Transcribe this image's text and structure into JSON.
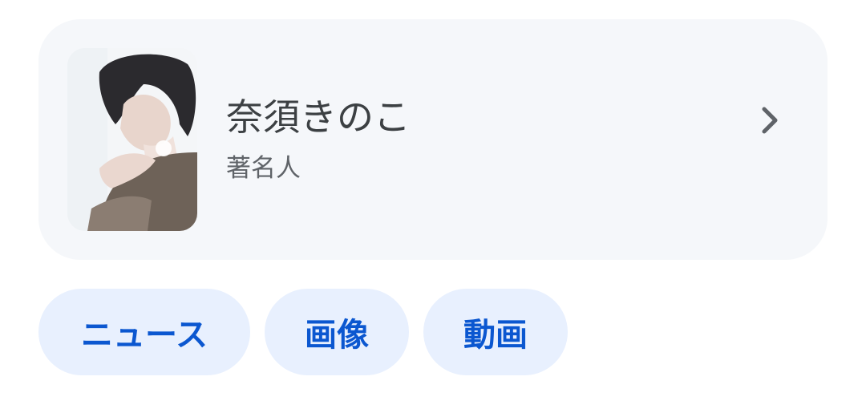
{
  "entity": {
    "name": "奈須きのこ",
    "category": "著名人",
    "thumbnail_icon": "person-photo",
    "chevron_icon": "chevron-right-icon"
  },
  "chips": [
    {
      "label": "ニュース"
    },
    {
      "label": "画像"
    },
    {
      "label": "動画"
    }
  ],
  "colors": {
    "card_bg": "#f5f7fa",
    "chip_bg": "#e8f0fe",
    "chip_text": "#0b57d0",
    "title_text": "#3c4043",
    "subtitle_text": "#5f6368"
  }
}
